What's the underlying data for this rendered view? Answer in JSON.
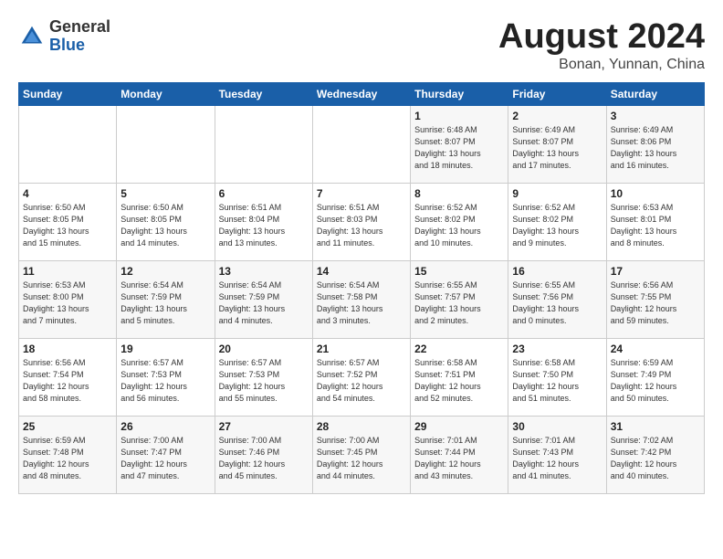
{
  "header": {
    "logo_general": "General",
    "logo_blue": "Blue",
    "month_year": "August 2024",
    "location": "Bonan, Yunnan, China"
  },
  "weekdays": [
    "Sunday",
    "Monday",
    "Tuesday",
    "Wednesday",
    "Thursday",
    "Friday",
    "Saturday"
  ],
  "weeks": [
    [
      {
        "day": "",
        "info": ""
      },
      {
        "day": "",
        "info": ""
      },
      {
        "day": "",
        "info": ""
      },
      {
        "day": "",
        "info": ""
      },
      {
        "day": "1",
        "info": "Sunrise: 6:48 AM\nSunset: 8:07 PM\nDaylight: 13 hours\nand 18 minutes."
      },
      {
        "day": "2",
        "info": "Sunrise: 6:49 AM\nSunset: 8:07 PM\nDaylight: 13 hours\nand 17 minutes."
      },
      {
        "day": "3",
        "info": "Sunrise: 6:49 AM\nSunset: 8:06 PM\nDaylight: 13 hours\nand 16 minutes."
      }
    ],
    [
      {
        "day": "4",
        "info": "Sunrise: 6:50 AM\nSunset: 8:05 PM\nDaylight: 13 hours\nand 15 minutes."
      },
      {
        "day": "5",
        "info": "Sunrise: 6:50 AM\nSunset: 8:05 PM\nDaylight: 13 hours\nand 14 minutes."
      },
      {
        "day": "6",
        "info": "Sunrise: 6:51 AM\nSunset: 8:04 PM\nDaylight: 13 hours\nand 13 minutes."
      },
      {
        "day": "7",
        "info": "Sunrise: 6:51 AM\nSunset: 8:03 PM\nDaylight: 13 hours\nand 11 minutes."
      },
      {
        "day": "8",
        "info": "Sunrise: 6:52 AM\nSunset: 8:02 PM\nDaylight: 13 hours\nand 10 minutes."
      },
      {
        "day": "9",
        "info": "Sunrise: 6:52 AM\nSunset: 8:02 PM\nDaylight: 13 hours\nand 9 minutes."
      },
      {
        "day": "10",
        "info": "Sunrise: 6:53 AM\nSunset: 8:01 PM\nDaylight: 13 hours\nand 8 minutes."
      }
    ],
    [
      {
        "day": "11",
        "info": "Sunrise: 6:53 AM\nSunset: 8:00 PM\nDaylight: 13 hours\nand 7 minutes."
      },
      {
        "day": "12",
        "info": "Sunrise: 6:54 AM\nSunset: 7:59 PM\nDaylight: 13 hours\nand 5 minutes."
      },
      {
        "day": "13",
        "info": "Sunrise: 6:54 AM\nSunset: 7:59 PM\nDaylight: 13 hours\nand 4 minutes."
      },
      {
        "day": "14",
        "info": "Sunrise: 6:54 AM\nSunset: 7:58 PM\nDaylight: 13 hours\nand 3 minutes."
      },
      {
        "day": "15",
        "info": "Sunrise: 6:55 AM\nSunset: 7:57 PM\nDaylight: 13 hours\nand 2 minutes."
      },
      {
        "day": "16",
        "info": "Sunrise: 6:55 AM\nSunset: 7:56 PM\nDaylight: 13 hours\nand 0 minutes."
      },
      {
        "day": "17",
        "info": "Sunrise: 6:56 AM\nSunset: 7:55 PM\nDaylight: 12 hours\nand 59 minutes."
      }
    ],
    [
      {
        "day": "18",
        "info": "Sunrise: 6:56 AM\nSunset: 7:54 PM\nDaylight: 12 hours\nand 58 minutes."
      },
      {
        "day": "19",
        "info": "Sunrise: 6:57 AM\nSunset: 7:53 PM\nDaylight: 12 hours\nand 56 minutes."
      },
      {
        "day": "20",
        "info": "Sunrise: 6:57 AM\nSunset: 7:53 PM\nDaylight: 12 hours\nand 55 minutes."
      },
      {
        "day": "21",
        "info": "Sunrise: 6:57 AM\nSunset: 7:52 PM\nDaylight: 12 hours\nand 54 minutes."
      },
      {
        "day": "22",
        "info": "Sunrise: 6:58 AM\nSunset: 7:51 PM\nDaylight: 12 hours\nand 52 minutes."
      },
      {
        "day": "23",
        "info": "Sunrise: 6:58 AM\nSunset: 7:50 PM\nDaylight: 12 hours\nand 51 minutes."
      },
      {
        "day": "24",
        "info": "Sunrise: 6:59 AM\nSunset: 7:49 PM\nDaylight: 12 hours\nand 50 minutes."
      }
    ],
    [
      {
        "day": "25",
        "info": "Sunrise: 6:59 AM\nSunset: 7:48 PM\nDaylight: 12 hours\nand 48 minutes."
      },
      {
        "day": "26",
        "info": "Sunrise: 7:00 AM\nSunset: 7:47 PM\nDaylight: 12 hours\nand 47 minutes."
      },
      {
        "day": "27",
        "info": "Sunrise: 7:00 AM\nSunset: 7:46 PM\nDaylight: 12 hours\nand 45 minutes."
      },
      {
        "day": "28",
        "info": "Sunrise: 7:00 AM\nSunset: 7:45 PM\nDaylight: 12 hours\nand 44 minutes."
      },
      {
        "day": "29",
        "info": "Sunrise: 7:01 AM\nSunset: 7:44 PM\nDaylight: 12 hours\nand 43 minutes."
      },
      {
        "day": "30",
        "info": "Sunrise: 7:01 AM\nSunset: 7:43 PM\nDaylight: 12 hours\nand 41 minutes."
      },
      {
        "day": "31",
        "info": "Sunrise: 7:02 AM\nSunset: 7:42 PM\nDaylight: 12 hours\nand 40 minutes."
      }
    ]
  ]
}
